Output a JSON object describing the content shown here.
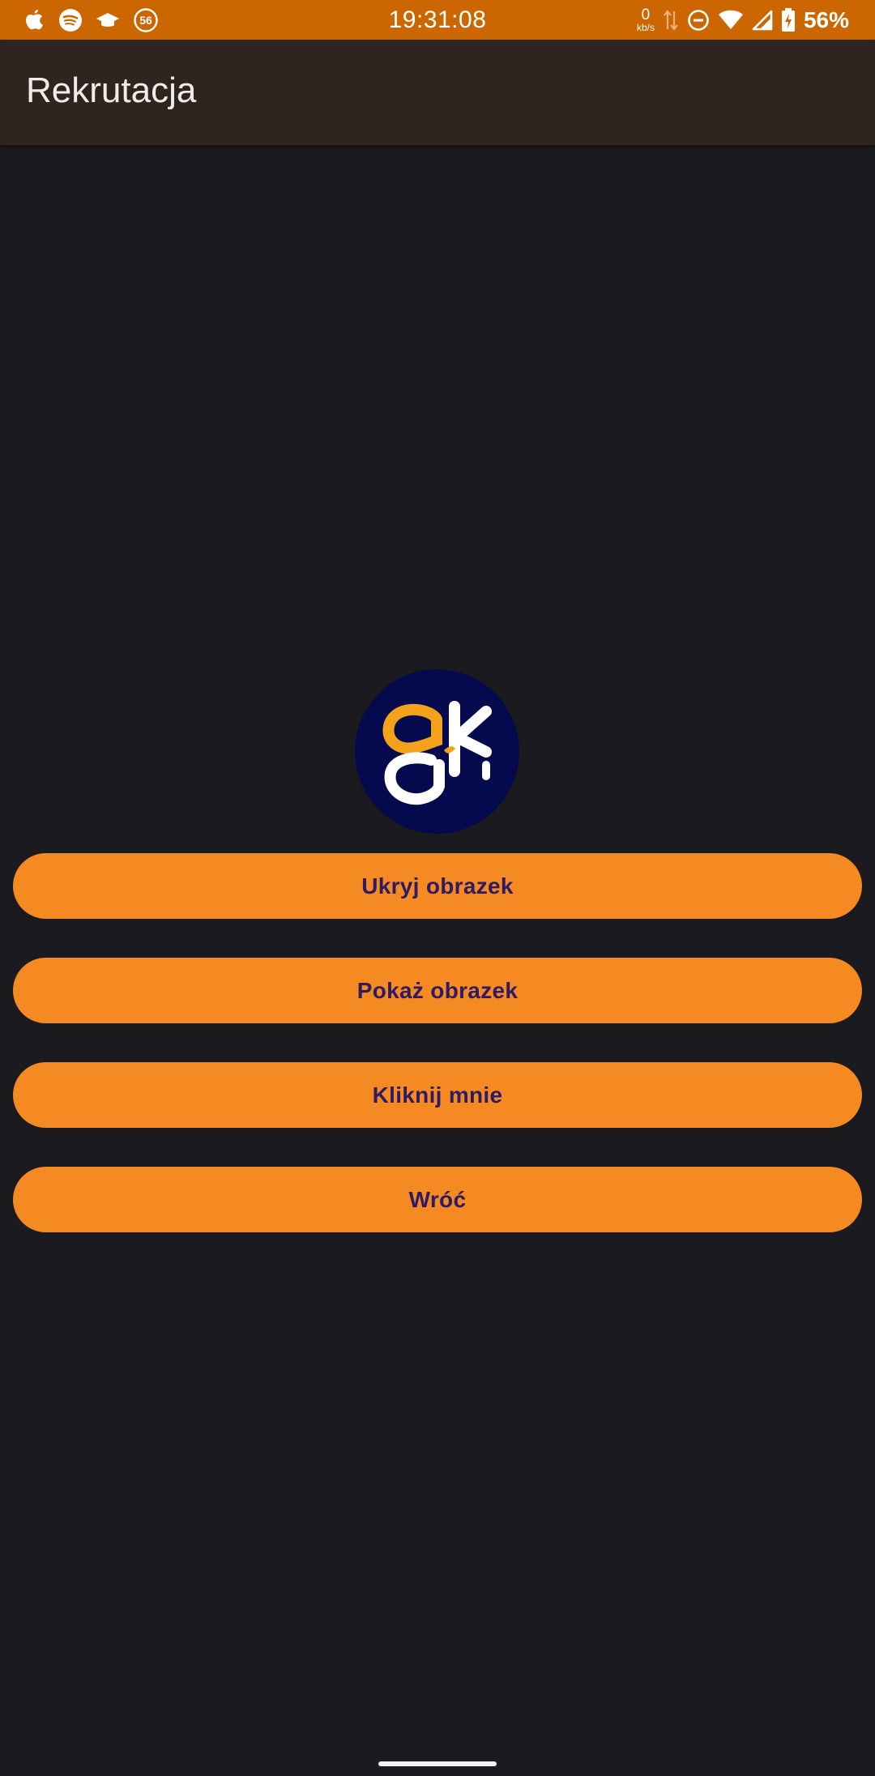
{
  "status_bar": {
    "time": "19:31:08",
    "left_icons": [
      "apple-icon",
      "spotify-icon",
      "graduation-cap-icon",
      "badge-56-icon"
    ],
    "badge_value": "56",
    "net_speed_value": "0",
    "net_speed_unit": "kb/s",
    "right_icons": [
      "data-arrows-icon",
      "do-not-disturb-icon",
      "wifi-icon",
      "cellular-signal-icon",
      "battery-charging-icon"
    ],
    "battery_percent": "56%",
    "background_color": "#cc6600"
  },
  "app_bar": {
    "title": "Rekrutacja",
    "background_color": "#2e2420"
  },
  "logo": {
    "icon": "akai-logo",
    "background_color": "#040a4d",
    "accent_color": "#f5a21b"
  },
  "buttons": {
    "hide_image": "Ukryj obrazek",
    "show_image": "Pokaż obrazek",
    "click_me": "Kliknij mnie",
    "back": "Wróć",
    "background_color": "#f68a22",
    "text_color": "#2f1a64"
  },
  "screen": {
    "background_color": "#1b1a1f"
  }
}
